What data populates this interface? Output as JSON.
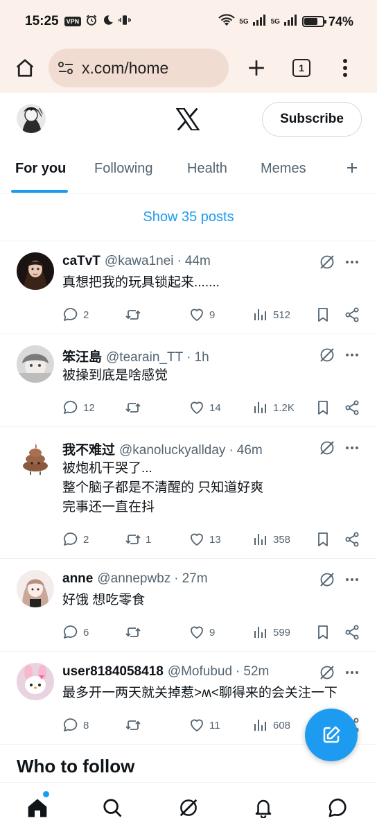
{
  "status_bar": {
    "time": "15:25",
    "vpn_label": "VPN",
    "network_1": "5G",
    "network_2": "5G",
    "battery_percent": "74%",
    "battery_level": 0.74
  },
  "browser": {
    "url": "x.com/home",
    "tab_count": "1"
  },
  "header": {
    "subscribe_label": "Subscribe"
  },
  "tabs": {
    "items": [
      {
        "label": "For you",
        "active": true
      },
      {
        "label": "Following",
        "active": false
      },
      {
        "label": "Health",
        "active": false
      },
      {
        "label": "Memes",
        "active": false
      }
    ]
  },
  "feed": {
    "show_posts": "Show 35 posts",
    "posts": [
      {
        "name": "caTvT",
        "handle": "@kawa1nei",
        "dot": "·",
        "time": "44m",
        "text": "真想把我的玩具锁起来.......",
        "replies": "2",
        "reposts": "",
        "likes": "9",
        "views": "512"
      },
      {
        "name": "笨汪島",
        "handle": "@tearain_TT",
        "dot": "·",
        "time": "1h",
        "text": "被操到底是啥感觉",
        "replies": "12",
        "reposts": "",
        "likes": "14",
        "views": "1.2K"
      },
      {
        "name": "我不难过",
        "handle": "@kanoluckyallday",
        "dot": "·",
        "time": "46m",
        "text": "被炮机干哭了...\n整个脑子都是不清醒的 只知道好爽\n完事还一直在抖",
        "replies": "2",
        "reposts": "1",
        "likes": "13",
        "views": "358"
      },
      {
        "name": "anne",
        "handle": "@annepwbz",
        "dot": "·",
        "time": "27m",
        "text": "好饿 想吃零食",
        "replies": "6",
        "reposts": "",
        "likes": "9",
        "views": "599"
      },
      {
        "name": "user8184058418",
        "handle": "@Mofubud",
        "dot": "·",
        "time": "52m",
        "text": "最多开一两天就关掉惹>ʍ<聊得来的会关注一下",
        "replies": "8",
        "reposts": "",
        "likes": "11",
        "views": "608"
      }
    ]
  },
  "who_to_follow": "Who to follow",
  "colors": {
    "accent": "#1d9bf0",
    "text_primary": "#0f1419",
    "text_secondary": "#536471",
    "browser_bg": "#fbf1ea",
    "url_bg": "#f1dcd1"
  }
}
